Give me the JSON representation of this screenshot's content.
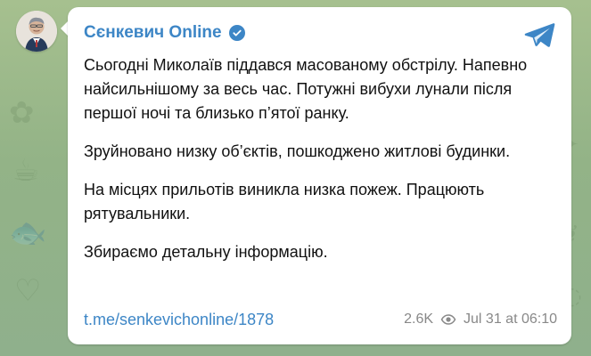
{
  "channel": {
    "name": "Сєнкевич Online"
  },
  "message": {
    "paragraphs": [
      "Сьогодні Миколаїв піддався масованому обстрілу. Напевно найсильнішому за весь час. Потужні вибухи лунали після першої ночі та близько п’ятої ранку.",
      "Зруйновано низку об’єктів, пошкоджено житлові будинки.",
      "На місцях прильотів виникла низка пожеж. Працюють рятувальники.",
      "Збираємо детальну інформацію."
    ],
    "link": "t.me/senkevichonline/1878",
    "views": "2.6K",
    "timestamp": "Jul 31 at 06:10"
  },
  "icons": {
    "avatar": "avatar",
    "verified": "verified-badge-icon",
    "telegram": "telegram-icon",
    "views": "eye-icon"
  },
  "colors": {
    "accent": "#3d86c6",
    "text": "#111111",
    "muted": "#888888",
    "bubble": "#ffffff",
    "background": "#9bb88b"
  }
}
